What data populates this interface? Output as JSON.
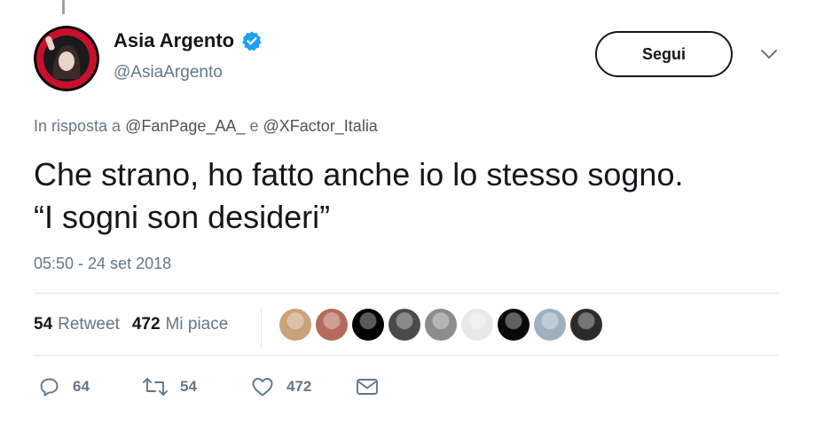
{
  "author": {
    "display_name": "Asia Argento",
    "handle": "@AsiaArgento",
    "avatar_icon": "profile-avatar",
    "verified_icon": "verified-badge-icon",
    "verified_color": "#1da1f2"
  },
  "follow_button_label": "Segui",
  "reply_context": {
    "prefix": "In risposta a",
    "user1": "@FanPage_AA_",
    "conjunction": "e",
    "user2": "@XFactor_Italia"
  },
  "tweet_text": {
    "line1": "Che strano, ho fatto anche io lo stesso sogno.",
    "line2": "“I sogni son desideri”"
  },
  "timestamp": "05:50 - 24 set 2018",
  "stats": {
    "retweets_count": "54",
    "retweets_label": "Retweet",
    "likes_count": "472",
    "likes_label": "Mi piace"
  },
  "liker_avatars": [
    {
      "color": "#c9a27a"
    },
    {
      "color": "#b46a5e"
    },
    {
      "color": "#000000"
    },
    {
      "color": "#4a4a4a"
    },
    {
      "color": "#8c8c8c"
    },
    {
      "color": "#e8e8e8"
    },
    {
      "color": "#0a0a0a"
    },
    {
      "color": "#9fb0bf"
    },
    {
      "color": "#2b2b2b"
    }
  ],
  "actions": {
    "reply_count": "64",
    "retweet_count": "54",
    "like_count": "472"
  },
  "colors": {
    "text_primary": "#14171a",
    "text_secondary": "#657786",
    "divider": "#e1e8ed"
  }
}
